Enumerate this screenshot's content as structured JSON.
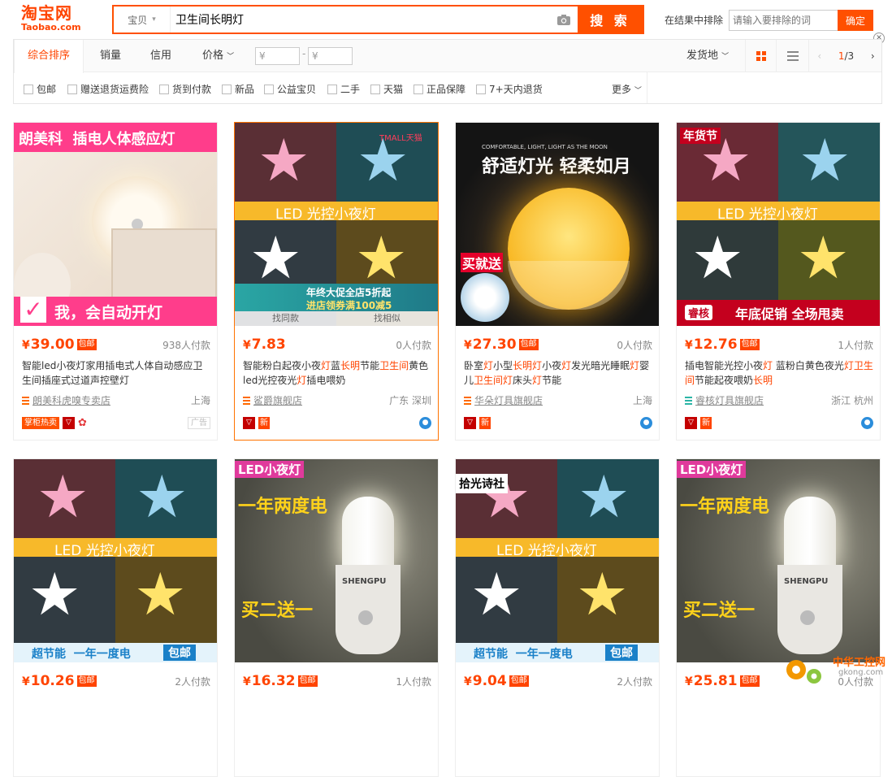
{
  "logo": {
    "cn": "淘宝网",
    "en": "Taobao.com"
  },
  "search": {
    "type": "宝贝",
    "query": "卫生间长明灯",
    "button": "搜 索"
  },
  "exclude": {
    "label": "在结果中排除",
    "placeholder": "请输入要排除的词",
    "button": "确定"
  },
  "sort": {
    "items": [
      "综合排序",
      "销量",
      "信用",
      "价格"
    ],
    "price_min": "¥",
    "price_max": "¥",
    "ship_from": "发货地",
    "page": "1/3"
  },
  "filters": [
    "包邮",
    "赠送退货运费险",
    "货到付款",
    "新品",
    "公益宝贝",
    "二手",
    "天猫",
    "正品保障",
    "7+天内退货"
  ],
  "filters_more": "更多",
  "products": [
    {
      "price": "39.00",
      "baoyou": "包邮",
      "deal": "938人付款",
      "title_parts": [
        "智能led小夜灯家用插电式人体自动感应卫生间插座式过道声控壁灯"
      ],
      "shop": "朗美科虎嗅专卖店",
      "loc": "上海",
      "img_top": "朗美科  插电人体感应灯",
      "img_bottom": "我，会自动开灯"
    },
    {
      "price": "7.83",
      "deal": "0人付款",
      "title_parts": [
        "智能粉白起夜小夜",
        "灯",
        "蓝",
        "长明",
        "节能",
        "卫生间",
        "黄色led光控夜光",
        "灯",
        "插电喂奶"
      ],
      "shop": "鲨爵旗舰店",
      "loc": "广东 深圳",
      "img_band": "LED 光控小夜灯",
      "img_tmall": "TMALL天猫",
      "img_promo1": "年终大促全店5折起",
      "img_promo2": "进店领券满100减5",
      "hover_left": "找同款",
      "hover_right": "找相似"
    },
    {
      "price": "27.30",
      "baoyou": "包邮",
      "deal": "0人付款",
      "title_parts": [
        "卧室",
        "灯",
        "小型",
        "长明灯",
        "小夜",
        "灯",
        "发光暗光睡眠",
        "灯",
        "婴儿",
        "卫生间灯",
        "床头",
        "灯",
        "节能"
      ],
      "shop": "华朵灯具旗舰店",
      "loc": "上海",
      "img_small": "COMFORTABLE, LIGHT, LIGHT AS THE MOON",
      "img_top": "舒适灯光 轻柔如月",
      "img_gift": "买就送"
    },
    {
      "price": "12.76",
      "baoyou": "包邮",
      "deal": "1人付款",
      "title_parts": [
        "插电智能光控小夜",
        "灯",
        " 蓝粉白黄色夜光",
        "灯卫生间",
        "节能起夜喂奶",
        "长明"
      ],
      "shop": "睿核灯具旗舰店",
      "loc": "浙江 杭州",
      "img_band": "LED 光控小夜灯",
      "img_fest": "年货节",
      "img_brand": "睿核",
      "img_bottom": "年底促销 全场甩卖"
    },
    {
      "price": "10.26",
      "baoyou": "包邮",
      "deal": "2人付款",
      "img_band": "LED 光控小夜灯",
      "img_bottom": "超节能  一年一度电",
      "img_baoyou": "包邮"
    },
    {
      "price": "16.32",
      "baoyou": "包邮",
      "deal": "1人付款",
      "img_tag": "LED小夜灯",
      "img_top": "一年两度电",
      "img_bottom": "买二送一",
      "img_brand": "SHENGPU"
    },
    {
      "price": "9.04",
      "baoyou": "包邮",
      "deal": "2人付款",
      "img_tag": "拾光诗社",
      "img_band": "LED 光控小夜灯",
      "img_bottom": "超节能  一年一度电",
      "img_baoyou": "包邮"
    },
    {
      "price": "25.81",
      "baoyou": "包邮",
      "deal": "0人付款",
      "img_tag": "LED小夜灯",
      "img_top": "一年两度电",
      "img_bottom": "买二送一",
      "img_brand": "SHENGPU"
    }
  ],
  "badges": {
    "zhangui": "掌柜热卖",
    "new": "新",
    "ad": "广告"
  },
  "watermark": {
    "cn": "中华工控网",
    "url": "gkong.com"
  }
}
